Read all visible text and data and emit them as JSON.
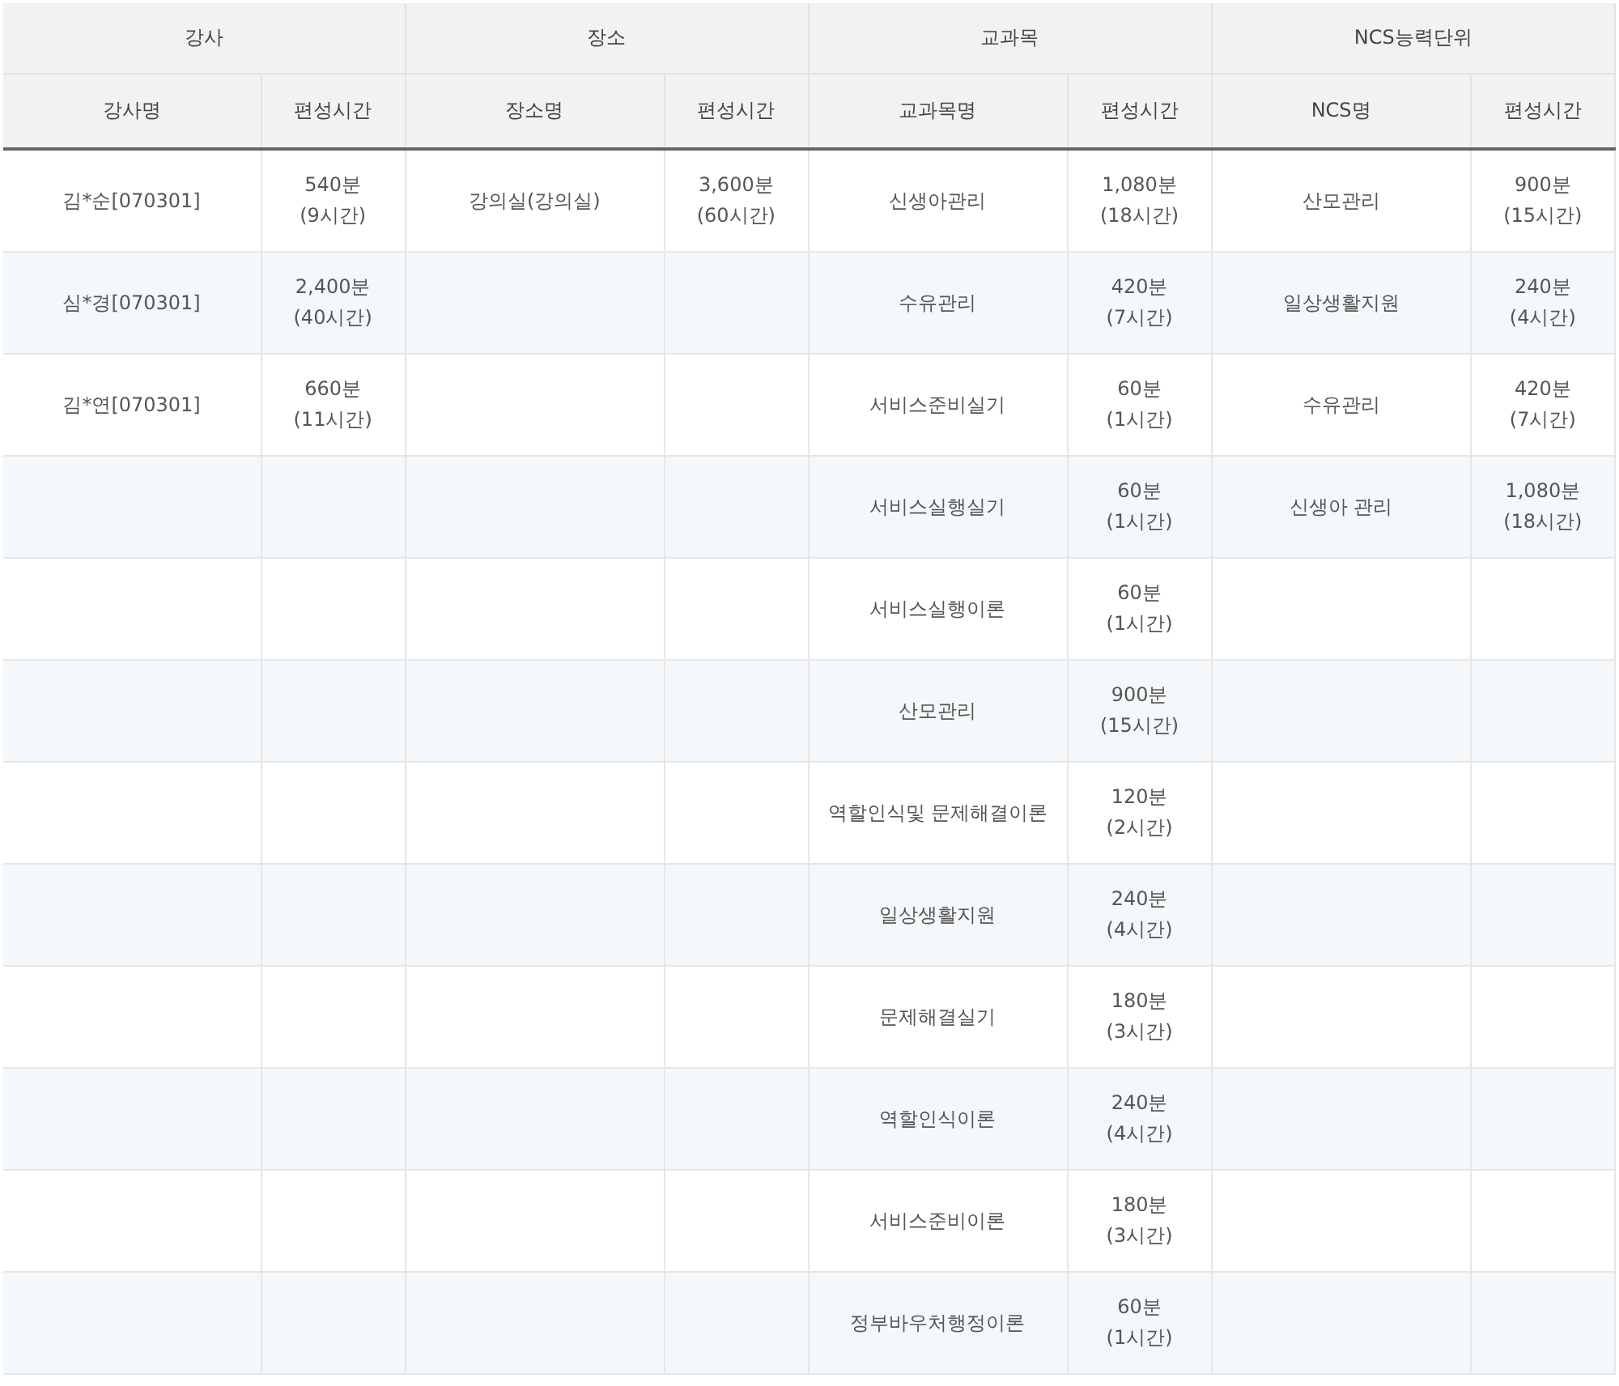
{
  "table": {
    "groups": [
      {
        "title": "강사",
        "columns": [
          "강사명",
          "편성시간"
        ]
      },
      {
        "title": "장소",
        "columns": [
          "장소명",
          "편성시간"
        ]
      },
      {
        "title": "교과목",
        "columns": [
          "교과목명",
          "편성시간"
        ]
      },
      {
        "title": "NCS능력단위",
        "columns": [
          "NCS명",
          "편성시간"
        ]
      }
    ],
    "rows": [
      {
        "cells": [
          "김*순[070301]",
          {
            "minutes": "540분",
            "hours": "(9시간)"
          },
          "강의실(강의실)",
          {
            "minutes": "3,600분",
            "hours": "(60시간)"
          },
          "신생아관리",
          {
            "minutes": "1,080분",
            "hours": "(18시간)"
          },
          "산모관리",
          {
            "minutes": "900분",
            "hours": "(15시간)"
          }
        ]
      },
      {
        "cells": [
          "심*경[070301]",
          {
            "minutes": "2,400분",
            "hours": "(40시간)"
          },
          null,
          null,
          "수유관리",
          {
            "minutes": "420분",
            "hours": "(7시간)"
          },
          "일상생활지원",
          {
            "minutes": "240분",
            "hours": "(4시간)"
          }
        ]
      },
      {
        "cells": [
          "김*연[070301]",
          {
            "minutes": "660분",
            "hours": "(11시간)"
          },
          null,
          null,
          "서비스준비실기",
          {
            "minutes": "60분",
            "hours": "(1시간)"
          },
          "수유관리",
          {
            "minutes": "420분",
            "hours": "(7시간)"
          }
        ]
      },
      {
        "cells": [
          null,
          null,
          null,
          null,
          "서비스실행실기",
          {
            "minutes": "60분",
            "hours": "(1시간)"
          },
          "신생아 관리",
          {
            "minutes": "1,080분",
            "hours": "(18시간)"
          }
        ]
      },
      {
        "cells": [
          null,
          null,
          null,
          null,
          "서비스실행이론",
          {
            "minutes": "60분",
            "hours": "(1시간)"
          },
          null,
          null
        ]
      },
      {
        "cells": [
          null,
          null,
          null,
          null,
          "산모관리",
          {
            "minutes": "900분",
            "hours": "(15시간)"
          },
          null,
          null
        ]
      },
      {
        "cells": [
          null,
          null,
          null,
          null,
          "역할인식및 문제해결이론",
          {
            "minutes": "120분",
            "hours": "(2시간)"
          },
          null,
          null
        ]
      },
      {
        "cells": [
          null,
          null,
          null,
          null,
          "일상생활지원",
          {
            "minutes": "240분",
            "hours": "(4시간)"
          },
          null,
          null
        ]
      },
      {
        "cells": [
          null,
          null,
          null,
          null,
          "문제해결실기",
          {
            "minutes": "180분",
            "hours": "(3시간)"
          },
          null,
          null
        ]
      },
      {
        "cells": [
          null,
          null,
          null,
          null,
          "역할인식이론",
          {
            "minutes": "240분",
            "hours": "(4시간)"
          },
          null,
          null
        ]
      },
      {
        "cells": [
          null,
          null,
          null,
          null,
          "서비스준비이론",
          {
            "minutes": "180분",
            "hours": "(3시간)"
          },
          null,
          null
        ]
      },
      {
        "cells": [
          null,
          null,
          null,
          null,
          "정부바우처행정이론",
          {
            "minutes": "60분",
            "hours": "(1시간)"
          },
          null,
          null
        ]
      }
    ]
  }
}
